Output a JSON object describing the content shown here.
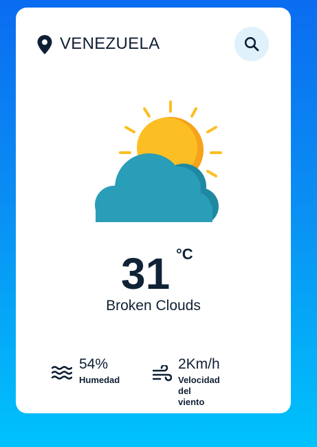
{
  "location": {
    "name": "VENEZUELA",
    "icon": "location-pin-icon"
  },
  "search": {
    "icon": "search-icon"
  },
  "weather": {
    "icon": "sun-behind-cloud-icon",
    "temperature": "31",
    "unit": "°C",
    "description": "Broken Clouds"
  },
  "details": {
    "humidity": {
      "value": "54%",
      "label": "Humedad",
      "icon": "waves-icon"
    },
    "wind": {
      "value": "2Km/h",
      "label_line1": "Velocidad del",
      "label_line2": "viento",
      "icon": "wind-icon"
    }
  },
  "colors": {
    "background_top": "#0a6cf0",
    "background_bottom": "#00c2fb",
    "card": "#ffffff",
    "text": "#0f1f33",
    "search_button": "#dff1fb",
    "sun": "#fbbf24",
    "sun_rays": "#fbbf24",
    "cloud": "#2a9db8",
    "cloud_shadow": "#1f88a3"
  }
}
